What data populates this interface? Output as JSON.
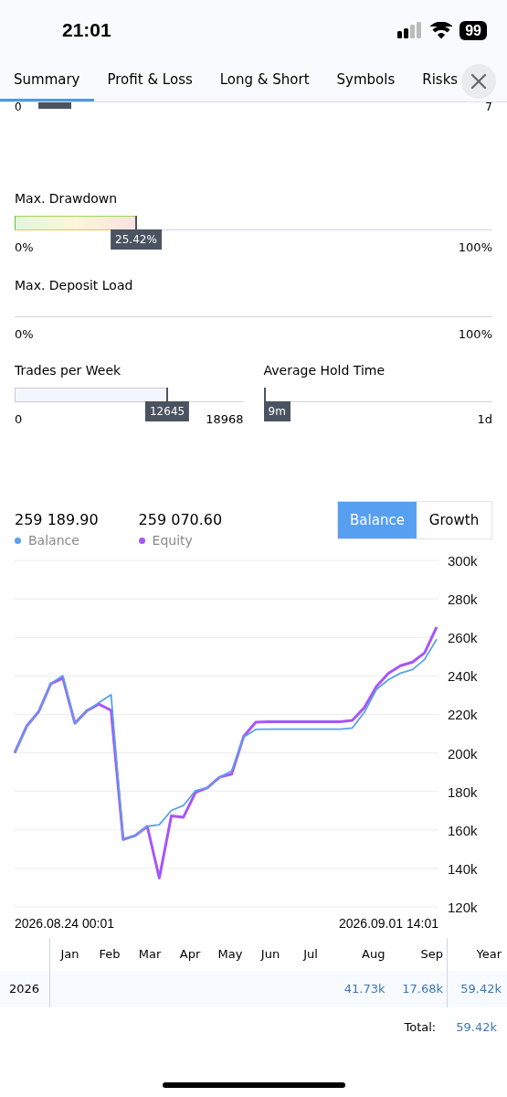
{
  "status_bar": {
    "time": "21:01",
    "battery": "99"
  },
  "tabs": [
    {
      "label": "Summary",
      "selected": true
    },
    {
      "label": "Profit & Loss",
      "selected": false
    },
    {
      "label": "Long & Short",
      "selected": false
    },
    {
      "label": "Symbols",
      "selected": false
    },
    {
      "label": "Risks",
      "selected": false
    }
  ],
  "partial_meter": {
    "min": "0",
    "max": "7",
    "level": 0.084
  },
  "meters": [
    {
      "label": "Max. Drawdown",
      "kind": "gradient",
      "level": 0.2542,
      "marker": "25.42%",
      "min": "0%",
      "max": "100%"
    },
    {
      "label": "Max. Deposit Load",
      "kind": "plain",
      "min": "0%",
      "max": "100%"
    }
  ],
  "half_meters": [
    {
      "label": "Trades per Week",
      "kind": "plain",
      "level": 0.667,
      "marker": "12645",
      "min": "0",
      "max": "18968"
    },
    {
      "label": "Average Hold Time",
      "kind": "plain",
      "level": 0,
      "marker": "9m",
      "max": "1d"
    }
  ],
  "chart_header": {
    "values": [
      "259 189.90",
      "259 070.60"
    ],
    "toggle": [
      {
        "label": "Balance",
        "selected": true
      },
      {
        "label": "Growth",
        "selected": false
      }
    ]
  },
  "chart": {
    "start_label": "2026.08.24 00:01",
    "end_label": "2026.09.01 14:01",
    "chart_data": {
      "type": "line",
      "grid": true,
      "categories": [
        null,
        null,
        null,
        null,
        null,
        null,
        null,
        null,
        null,
        null,
        null,
        null,
        null,
        null,
        null,
        null,
        null,
        null,
        null,
        null,
        null,
        null,
        null,
        null,
        null,
        null,
        null,
        null,
        null,
        null,
        null,
        null,
        null,
        null,
        null,
        null
      ],
      "series": [
        {
          "name": "Balance",
          "color": "#5aa0ec",
          "values": [
            200,
            213.9,
            221.4,
            236,
            240.1,
            215.4,
            221.9,
            226.2,
            230.2,
            155,
            157,
            161.8,
            162.7,
            170.1,
            172.6,
            180.4,
            181.9,
            187.4,
            190.6,
            208.2,
            212.2,
            212.3,
            212.3,
            212.3,
            212.3,
            212.3,
            212.3,
            212.3,
            212.9,
            221,
            232.9,
            238,
            241.4,
            243.3,
            248.5,
            259
          ]
        },
        {
          "name": "Equity",
          "color": "#a855f7",
          "values": [
            200,
            213.9,
            221.4,
            235.9,
            238.8,
            215.4,
            221.9,
            225.3,
            222.1,
            155,
            157,
            161.8,
            135,
            167.3,
            166.6,
            179.4,
            181.9,
            187.4,
            189,
            208.6,
            215.9,
            216.2,
            216.2,
            216.2,
            216.2,
            216.2,
            216.2,
            216.2,
            216.9,
            223.5,
            234.4,
            241.4,
            245.3,
            247.2,
            252,
            265.4
          ]
        }
      ],
      "ylim": [
        120,
        300
      ],
      "yticks": [
        {
          "value": 300,
          "label": "300k"
        },
        {
          "value": 280,
          "label": "280k"
        },
        {
          "value": 260,
          "label": "260k"
        },
        {
          "value": 240,
          "label": "240k"
        },
        {
          "value": 220,
          "label": "220k"
        },
        {
          "value": 200,
          "label": "200k"
        },
        {
          "value": 180,
          "label": "180k"
        },
        {
          "value": 160,
          "label": "160k"
        },
        {
          "value": 140,
          "label": "140k"
        },
        {
          "value": 120,
          "label": "120k"
        }
      ]
    }
  },
  "monthly": {
    "columns": [
      "Jan",
      "Feb",
      "Mar",
      "Apr",
      "May",
      "Jun",
      "Jul",
      "Aug",
      "Sep"
    ],
    "year_column": "Year",
    "rows": [
      {
        "year": "2026",
        "months": [
          "41.73k",
          "17.68k"
        ],
        "total": "59.42k"
      }
    ],
    "total_label": "Total:",
    "total": "59.42k"
  }
}
